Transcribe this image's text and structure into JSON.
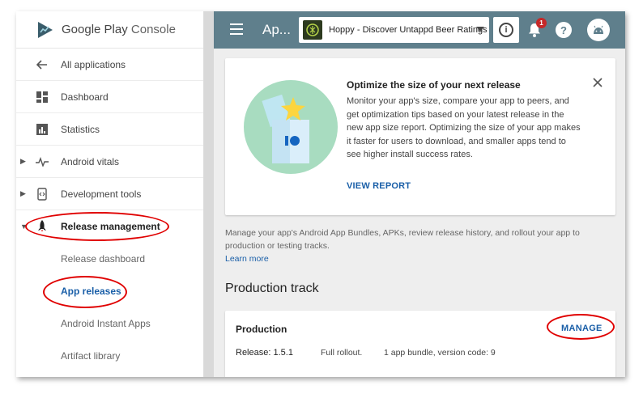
{
  "brand": {
    "name_a": "Google Play",
    "name_b": "Console"
  },
  "sidebar": {
    "items": [
      {
        "label": "All applications",
        "icon": "arrow-back-icon"
      },
      {
        "label": "Dashboard",
        "icon": "dashboard-icon"
      },
      {
        "label": "Statistics",
        "icon": "statistics-icon"
      },
      {
        "label": "Android vitals",
        "icon": "vitals-icon",
        "caret": "▶"
      },
      {
        "label": "Development tools",
        "icon": "dev-tools-icon",
        "caret": "▶"
      },
      {
        "label": "Release management",
        "icon": "rocket-icon",
        "caret": "▼"
      }
    ],
    "sub_items": [
      {
        "label": "Release dashboard"
      },
      {
        "label": "App releases"
      },
      {
        "label": "Android Instant Apps"
      },
      {
        "label": "Artifact library"
      }
    ]
  },
  "topbar": {
    "title": "Ap...",
    "app_name": "Hoppy - Discover Untappd Beer Ratings",
    "notification_count": "1",
    "help_label": "?",
    "info_label": "i"
  },
  "promo": {
    "title": "Optimize the size of your next release",
    "body": "Monitor your app's size, compare your app to peers, and get optimization tips based on your latest release in the new app size report. Optimizing the size of your app makes it faster for users to download, and smaller apps tend to see higher install success rates.",
    "link": "VIEW REPORT"
  },
  "intro": {
    "text": "Manage your app's Android App Bundles, APKs, review release history, and rollout your app to production or testing tracks.",
    "link": "Learn more"
  },
  "production": {
    "section_title": "Production track",
    "card_title": "Production",
    "manage": "MANAGE",
    "release": "Release: 1.5.1",
    "rollout": "Full rollout.",
    "bundle": "1 app bundle, version code: 9"
  },
  "colors": {
    "topbar": "#5f7f8c",
    "link": "#1a5fa8",
    "annotation": "#e00000"
  }
}
